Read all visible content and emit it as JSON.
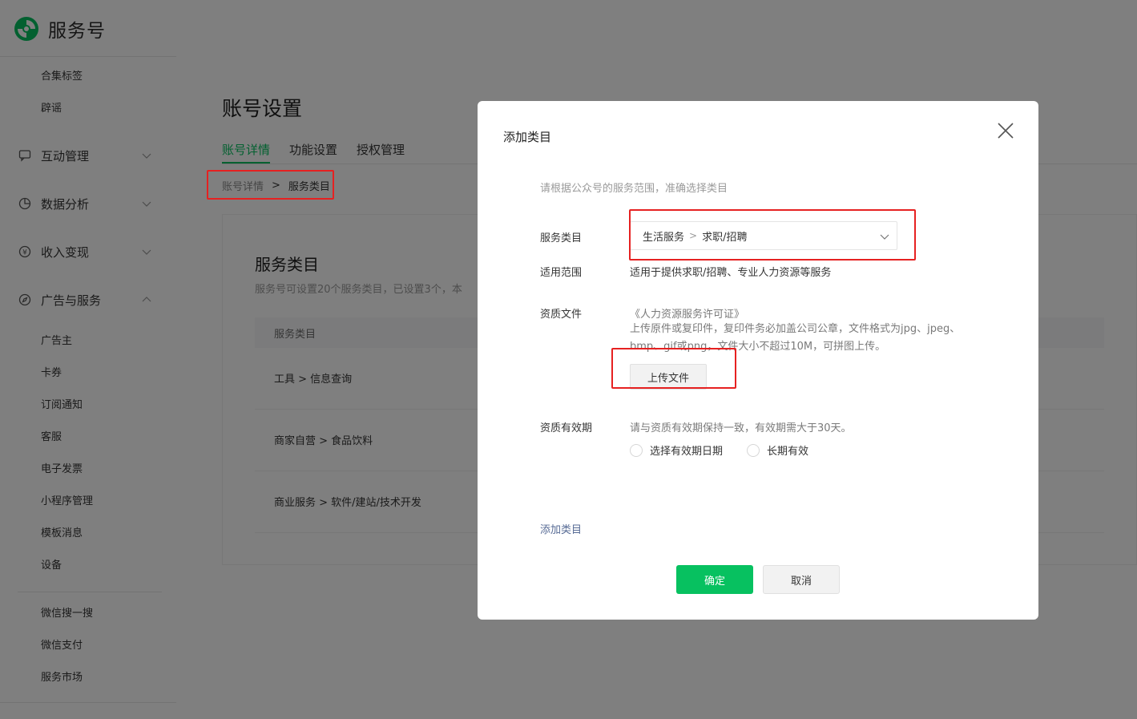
{
  "app": {
    "logo_text": "服务号"
  },
  "sidebar": {
    "top_items": [
      {
        "label": "合集标签"
      },
      {
        "label": "辟谣"
      }
    ],
    "groups": [
      {
        "label": "互动管理",
        "icon": "chat-icon"
      },
      {
        "label": "数据分析",
        "icon": "pie-chart-icon"
      },
      {
        "label": "收入变现",
        "icon": "yen-icon"
      },
      {
        "label": "广告与服务",
        "icon": "compass-icon"
      }
    ],
    "ad_items": [
      {
        "label": "广告主"
      },
      {
        "label": "卡券"
      },
      {
        "label": "订阅通知"
      },
      {
        "label": "客服"
      },
      {
        "label": "电子发票"
      },
      {
        "label": "小程序管理"
      },
      {
        "label": "模板消息"
      },
      {
        "label": "设备"
      }
    ],
    "extra_items": [
      {
        "label": "微信搜一搜"
      },
      {
        "label": "微信支付"
      },
      {
        "label": "服务市场"
      }
    ]
  },
  "main": {
    "title": "账号设置",
    "tabs": [
      {
        "label": "账号详情",
        "active": true
      },
      {
        "label": "功能设置",
        "active": false
      },
      {
        "label": "授权管理",
        "active": false
      }
    ],
    "breadcrumb": {
      "parent": "账号详情",
      "separator": ">",
      "current": "服务类目"
    },
    "card": {
      "title": "服务类目",
      "desc": "服务号可设置20个服务类目，已设置3个，本",
      "table_header": "服务类目",
      "rows": [
        {
          "text": "工具  >  信息查询"
        },
        {
          "text": "商家自营  >  食品饮料"
        },
        {
          "text": "商业服务  >  软件/建站/技术开发"
        }
      ]
    }
  },
  "dialog": {
    "title": "添加类目",
    "hint": "请根据公众号的服务范围，准确选择类目",
    "category_label": "服务类目",
    "category_value": {
      "level1": "生活服务",
      "separator": ">",
      "level2": "求职/招聘"
    },
    "scope_label": "适用范围",
    "scope_value": "适用于提供求职/招聘、专业人力资源等服务",
    "doc_label": "资质文件",
    "doc_name": "《人力资源服务许可证》",
    "doc_desc": "上传原件或复印件，复印件务必加盖公司公章，文件格式为jpg、jpeg、bmp、gif或png，文件大小不超过10M，可拼图上传。",
    "upload_button": "上传文件",
    "validity_label": "资质有效期",
    "validity_hint": "请与资质有效期保持一致，有效期需大于30天。",
    "radio_options": [
      {
        "label": "选择有效期日期"
      },
      {
        "label": "长期有效"
      }
    ],
    "add_link": "添加类目",
    "ok_button": "确定",
    "cancel_button": "取消"
  },
  "colors": {
    "brand_green": "#07c160",
    "link_blue": "#576b95",
    "annotation_red": "#e62121",
    "overlay": "rgba(0,0,0,0.5)"
  }
}
